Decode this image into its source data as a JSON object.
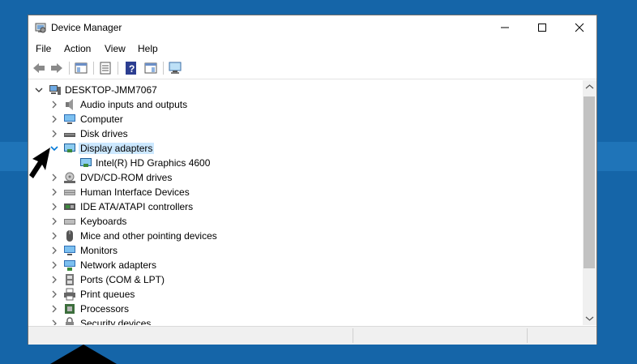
{
  "window": {
    "title": "Device Manager",
    "controls": {
      "minimize": "minimize",
      "maximize": "maximize",
      "close": "close"
    }
  },
  "menu": [
    "File",
    "Action",
    "View",
    "Help"
  ],
  "toolbar": {
    "icons": [
      "back-arrow-icon",
      "forward-arrow-icon",
      "show-hide-console-tree-icon",
      "properties-icon",
      "help-icon",
      "action-pane-icon",
      "scan-hardware-icon"
    ]
  },
  "tree": {
    "root": "DESKTOP-JMM7067",
    "items": [
      {
        "label": "Audio inputs and outputs",
        "icon": "speaker-icon"
      },
      {
        "label": "Computer",
        "icon": "computer-icon"
      },
      {
        "label": "Disk drives",
        "icon": "disk-drive-icon"
      },
      {
        "label": "Display adapters",
        "icon": "display-adapter-icon",
        "expanded": true,
        "selected": true,
        "children": [
          "Intel(R) HD Graphics 4600"
        ]
      },
      {
        "label": "DVD/CD-ROM drives",
        "icon": "dvd-drive-icon"
      },
      {
        "label": "Human Interface Devices",
        "icon": "hid-icon"
      },
      {
        "label": "IDE ATA/ATAPI controllers",
        "icon": "ide-controller-icon"
      },
      {
        "label": "Keyboards",
        "icon": "keyboard-icon"
      },
      {
        "label": "Mice and other pointing devices",
        "icon": "mouse-icon"
      },
      {
        "label": "Monitors",
        "icon": "monitor-icon"
      },
      {
        "label": "Network adapters",
        "icon": "network-adapter-icon"
      },
      {
        "label": "Ports (COM & LPT)",
        "icon": "port-icon"
      },
      {
        "label": "Print queues",
        "icon": "printer-icon"
      },
      {
        "label": "Processors",
        "icon": "processor-icon"
      },
      {
        "label": "Security devices",
        "icon": "security-device-icon"
      }
    ]
  },
  "colors": {
    "selection": "#cce8ff",
    "accent": "#0078d7",
    "desktop": "#1565a8"
  }
}
